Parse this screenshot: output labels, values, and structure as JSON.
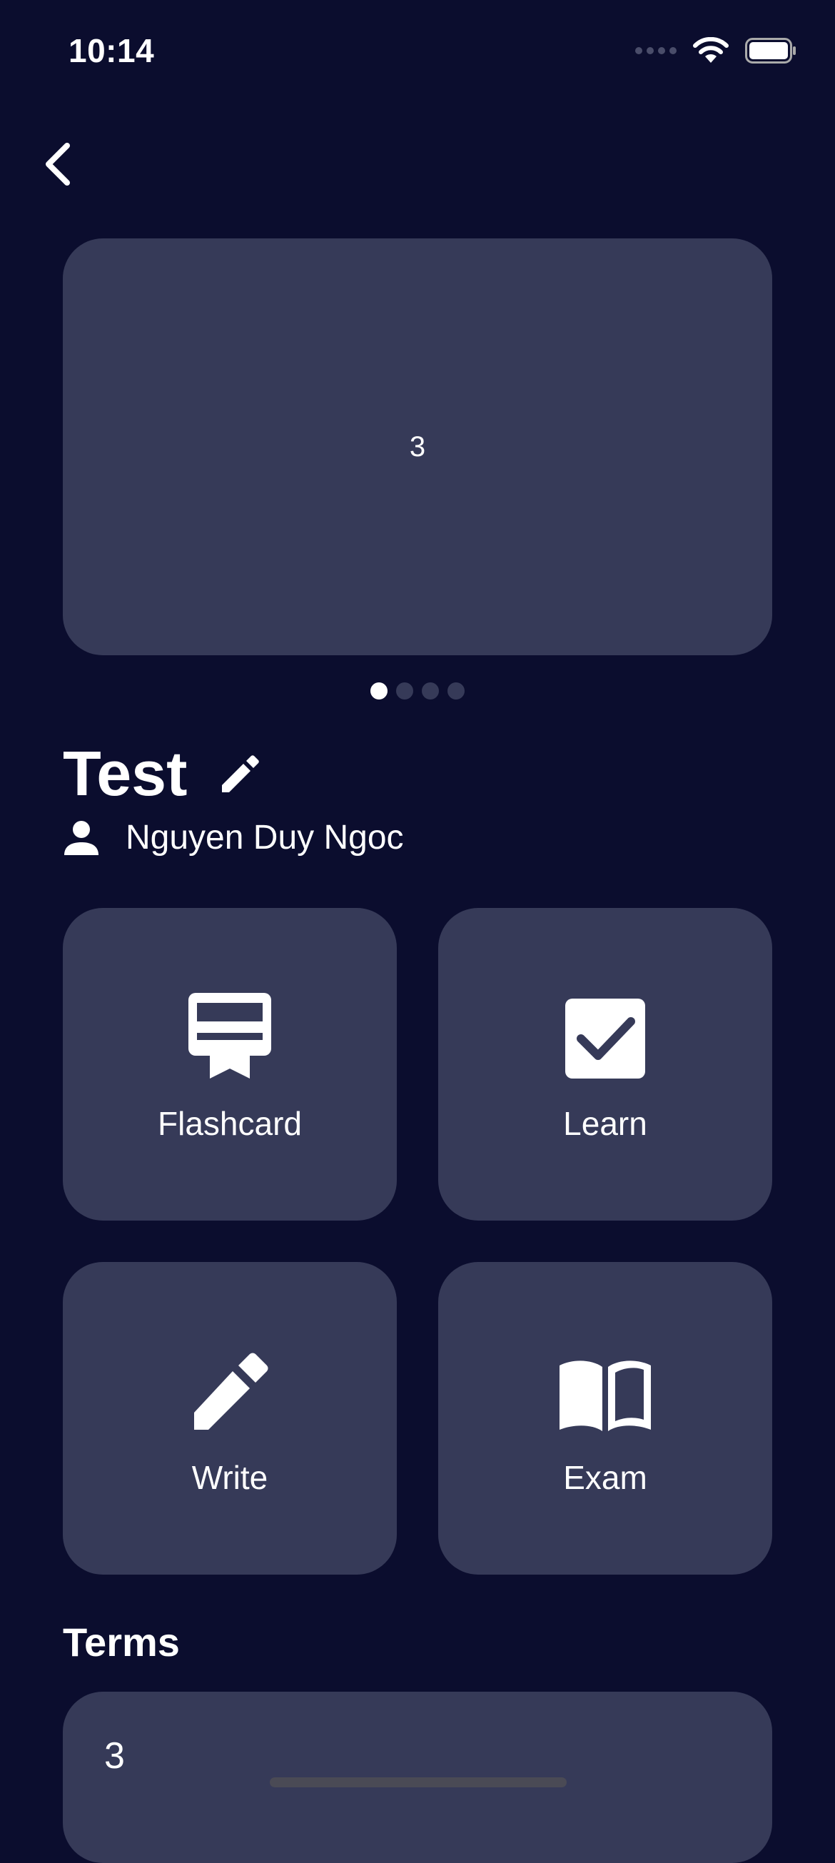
{
  "status_bar": {
    "time": "10:14"
  },
  "carousel": {
    "current_card_text": "3",
    "page_count": 4,
    "active_page": 1
  },
  "study_set": {
    "title": "Test",
    "author": "Nguyen Duy Ngoc"
  },
  "modes": [
    {
      "label": "Flashcard",
      "icon": "flashcard-icon"
    },
    {
      "label": "Learn",
      "icon": "checkbox-icon"
    },
    {
      "label": "Write",
      "icon": "pencil-icon"
    },
    {
      "label": "Exam",
      "icon": "book-icon"
    }
  ],
  "terms": {
    "heading": "Terms",
    "items": [
      {
        "text": "3"
      }
    ]
  },
  "colors": {
    "background": "#0b0d2e",
    "card": "#363a58",
    "text": "#ffffff"
  }
}
